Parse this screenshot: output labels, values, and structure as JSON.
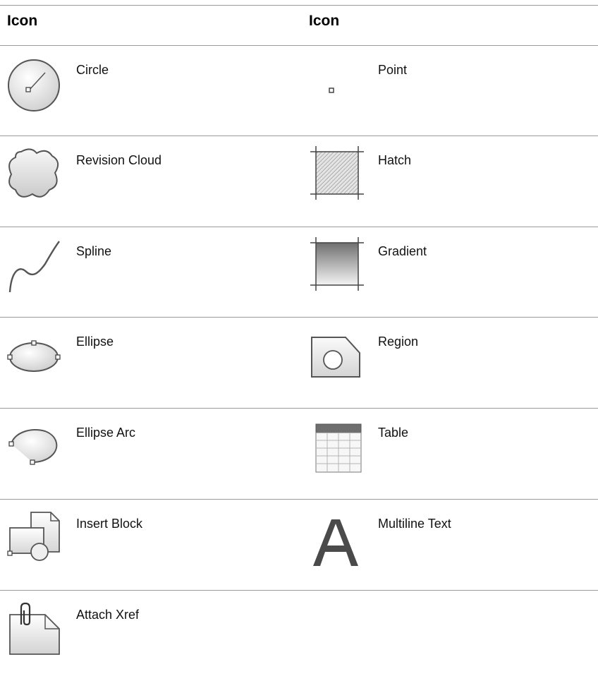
{
  "header": {
    "col1": "Icon",
    "col2": "Icon"
  },
  "rows": [
    {
      "left": {
        "label": "Circle",
        "icon": "circle-icon"
      },
      "right": {
        "label": "Point",
        "icon": "point-icon"
      }
    },
    {
      "left": {
        "label": "Revision Cloud",
        "icon": "revision-cloud-icon"
      },
      "right": {
        "label": "Hatch",
        "icon": "hatch-icon"
      }
    },
    {
      "left": {
        "label": "Spline",
        "icon": "spline-icon"
      },
      "right": {
        "label": "Gradient",
        "icon": "gradient-icon"
      }
    },
    {
      "left": {
        "label": "Ellipse",
        "icon": "ellipse-icon"
      },
      "right": {
        "label": "Region",
        "icon": "region-icon"
      }
    },
    {
      "left": {
        "label": "Ellipse Arc",
        "icon": "ellipse-arc-icon"
      },
      "right": {
        "label": "Table",
        "icon": "table-icon"
      }
    },
    {
      "left": {
        "label": "Insert Block",
        "icon": "insert-block-icon"
      },
      "right": {
        "label": "Multiline Text",
        "icon": "multiline-text-icon"
      }
    },
    {
      "left": {
        "label": "Attach Xref",
        "icon": "attach-xref-icon"
      },
      "right": {
        "label": "",
        "icon": ""
      }
    }
  ]
}
